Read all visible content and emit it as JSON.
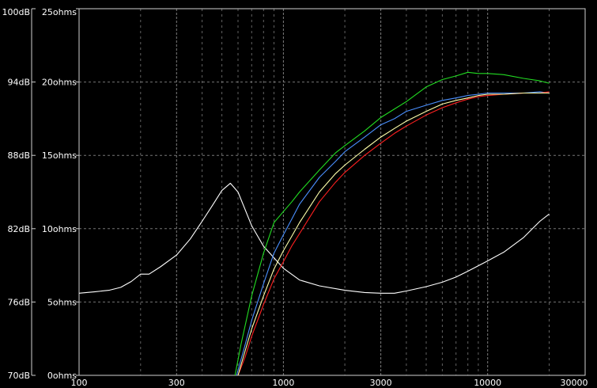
{
  "chart_data": {
    "type": "line",
    "title": "",
    "xlabel": "",
    "ylabel": "",
    "x_scale": "log",
    "xlim": [
      100,
      30000
    ],
    "x_ticks": [
      100,
      300,
      1000,
      3000,
      10000,
      30000
    ],
    "x_tick_labels": [
      "100",
      "300",
      "1000",
      "3000",
      "10000",
      "30000"
    ],
    "y_left_label_ticks": [
      "70dB",
      "76dB",
      "82dB",
      "88dB",
      "94dB",
      "100dB"
    ],
    "y_right_label_ticks": [
      "0ohms",
      "5ohms",
      "10ohms",
      "15ohms",
      "20ohms",
      "25ohms"
    ],
    "ylim_db": [
      70,
      100
    ],
    "ylim_ohms": [
      0,
      25
    ],
    "grid": true,
    "colors": {
      "background": "#000000",
      "grid": "#8a8a8a",
      "axis": "#cfcfcf",
      "text": "#ffffff"
    },
    "series": [
      {
        "color": "#ffffff",
        "unit": "ohms",
        "x": [
          100,
          120,
          140,
          160,
          180,
          200,
          220,
          250,
          300,
          350,
          400,
          450,
          500,
          550,
          600,
          700,
          800,
          1000,
          1200,
          1500,
          2000,
          2500,
          3000,
          3500,
          4000,
          5000,
          6000,
          7000,
          8000,
          10000,
          12000,
          15000,
          18000,
          20000
        ],
        "y": [
          5.6,
          5.7,
          5.8,
          6.0,
          6.4,
          6.9,
          6.9,
          7.4,
          8.2,
          9.3,
          10.5,
          11.6,
          12.6,
          13.1,
          12.5,
          10.2,
          8.8,
          7.3,
          6.5,
          6.1,
          5.8,
          5.65,
          5.6,
          5.6,
          5.75,
          6.05,
          6.35,
          6.7,
          7.1,
          7.8,
          8.4,
          9.4,
          10.5,
          11.0
        ]
      },
      {
        "color": "#22dd22",
        "unit": "dB",
        "x": [
          580,
          620,
          700,
          800,
          900,
          1000,
          1100,
          1200,
          1500,
          1800,
          2000,
          2500,
          3000,
          3500,
          4000,
          5000,
          6000,
          7000,
          8000,
          9000,
          10000,
          12000,
          15000,
          18000,
          20000
        ],
        "y": [
          70.0,
          72.5,
          76.5,
          80.0,
          82.5,
          83.4,
          84.2,
          85.0,
          86.8,
          88.2,
          88.8,
          90.0,
          91.1,
          91.8,
          92.4,
          93.6,
          94.2,
          94.5,
          94.8,
          94.7,
          94.7,
          94.6,
          94.3,
          94.1,
          93.9
        ]
      },
      {
        "color": "#4a90ff",
        "unit": "dB",
        "x": [
          590,
          650,
          700,
          800,
          900,
          1000,
          1100,
          1200,
          1500,
          1800,
          2000,
          2500,
          3000,
          3500,
          4000,
          5000,
          6000,
          7000,
          8000,
          9000,
          10000,
          12000,
          15000,
          18000,
          20000
        ],
        "y": [
          70.0,
          72.5,
          74.5,
          77.5,
          80.0,
          81.5,
          82.8,
          84.0,
          86.2,
          87.5,
          88.3,
          89.5,
          90.5,
          91.0,
          91.6,
          92.1,
          92.5,
          92.7,
          92.9,
          93.0,
          93.1,
          93.1,
          93.1,
          93.2,
          93.1
        ]
      },
      {
        "color": "#ff2020",
        "unit": "dB",
        "x": [
          600,
          650,
          700,
          800,
          900,
          1000,
          1100,
          1200,
          1500,
          1800,
          2000,
          2500,
          3000,
          3500,
          4000,
          5000,
          6000,
          7000,
          8000,
          9000,
          10000,
          12000,
          15000,
          18000,
          20000
        ],
        "y": [
          70.0,
          71.5,
          73.2,
          75.8,
          77.9,
          79.3,
          80.6,
          81.6,
          84.2,
          85.8,
          86.6,
          88.0,
          89.0,
          89.8,
          90.4,
          91.3,
          91.9,
          92.3,
          92.6,
          92.8,
          92.9,
          93.0,
          93.1,
          93.1,
          93.2
        ]
      },
      {
        "color": "#ffffaa",
        "unit": "dB",
        "x": [
          600,
          650,
          700,
          800,
          900,
          1000,
          1100,
          1200,
          1500,
          1800,
          2000,
          2500,
          3000,
          3500,
          4000,
          5000,
          6000,
          7000,
          8000,
          9000,
          10000,
          12000,
          15000,
          18000,
          20000
        ],
        "y": [
          70.0,
          72.0,
          73.8,
          76.5,
          78.7,
          80.2,
          81.4,
          82.5,
          85.0,
          86.5,
          87.2,
          88.5,
          89.5,
          90.2,
          90.8,
          91.6,
          92.2,
          92.5,
          92.7,
          92.9,
          93.0,
          93.0,
          93.1,
          93.1,
          93.1
        ]
      }
    ]
  }
}
